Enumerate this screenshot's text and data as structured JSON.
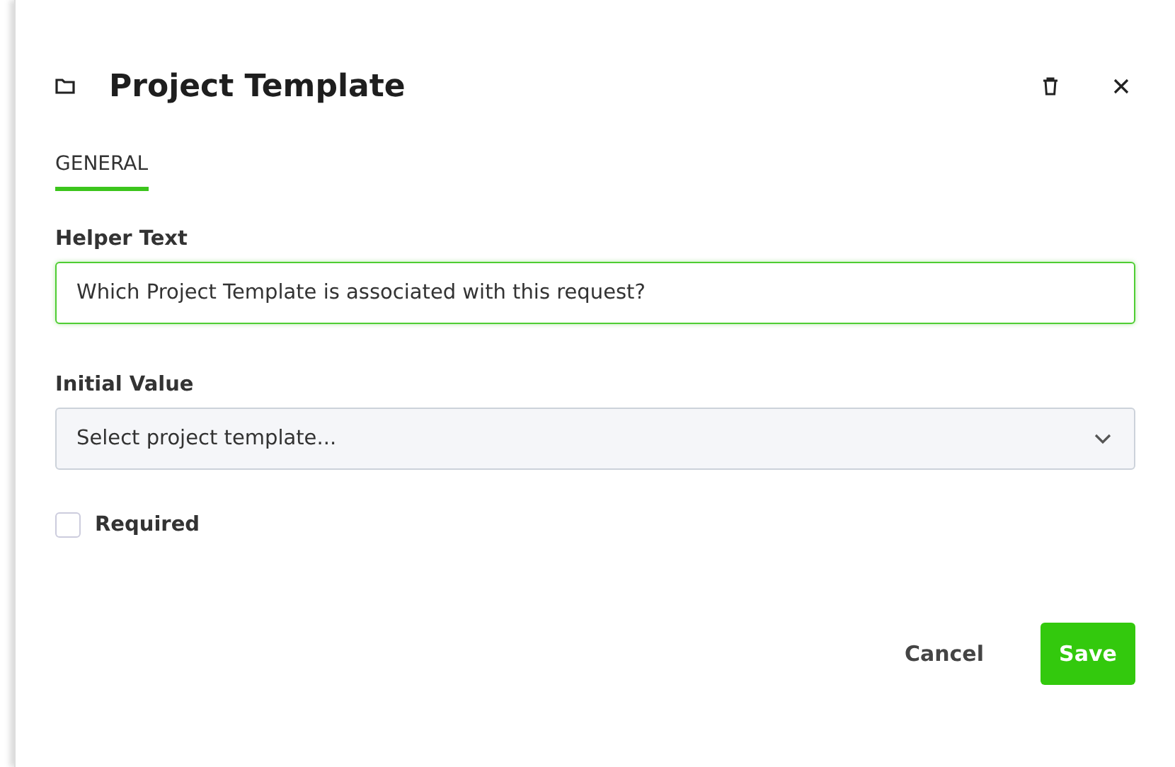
{
  "dialog": {
    "title": "Project Template"
  },
  "tabs": [
    {
      "label": "GENERAL",
      "selected": true
    }
  ],
  "fields": [
    {
      "kind": "text",
      "label": "Helper Text",
      "value": "Which Project Template is associated with this request?",
      "focused": true
    },
    {
      "kind": "select",
      "label": "Initial Value",
      "placeholder": "Select project template...",
      "focused": false
    },
    {
      "kind": "checkbox",
      "label": "Required",
      "checked": false
    }
  ],
  "buttons": [
    {
      "label": "Cancel",
      "kind": "secondary"
    },
    {
      "label": "Save",
      "kind": "primary"
    }
  ]
}
